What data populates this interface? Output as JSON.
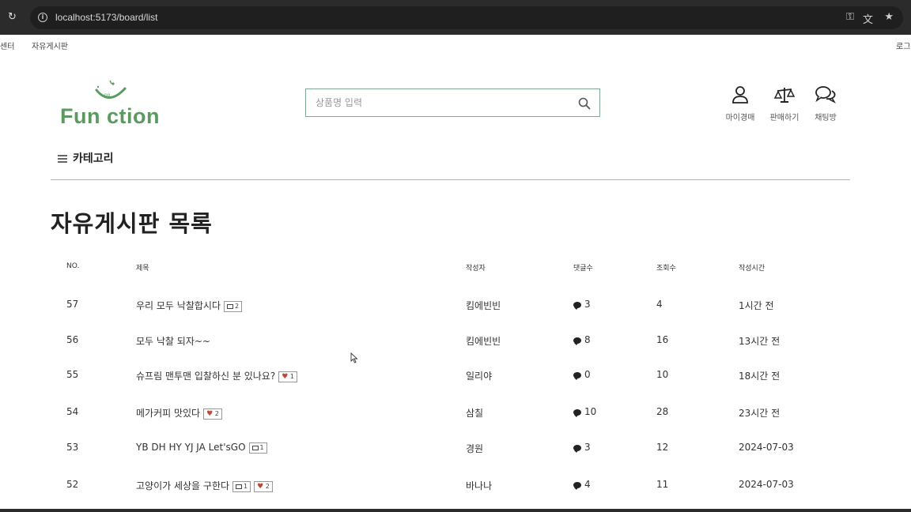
{
  "browser": {
    "url": "localhost:5173/board/list"
  },
  "utility_links": {
    "left_1": "센터",
    "left_2": "자유게시판",
    "right_1": "로그"
  },
  "logo": {
    "text": "Fun ction"
  },
  "search": {
    "placeholder": "상품명 입력"
  },
  "header_menu": {
    "my": "마이경매",
    "sell": "판매하기",
    "chat": "채팅방"
  },
  "category_label": "카테고리",
  "page_title": "자유게시판 목록",
  "table": {
    "headers": {
      "no": "NO.",
      "title": "제목",
      "author": "작성자",
      "comments": "댓글수",
      "views": "조회수",
      "time": "작성시간"
    },
    "rows": [
      {
        "no": "57",
        "title": "우리 모두 낙찰합시다",
        "images": "2",
        "likes": "",
        "author": "킴에빈빈",
        "comments": "3",
        "views": "4",
        "time": "1시간 전"
      },
      {
        "no": "56",
        "title": "모두 낙찰 되자~~",
        "images": "",
        "likes": "",
        "author": "킴에빈빈",
        "comments": "8",
        "views": "16",
        "time": "13시간 전"
      },
      {
        "no": "55",
        "title": "슈프림 맨투맨 입찰하신 분 있나요?",
        "images": "",
        "likes": "1",
        "author": "일리야",
        "comments": "0",
        "views": "10",
        "time": "18시간 전"
      },
      {
        "no": "54",
        "title": "메가커피 맛있다",
        "images": "",
        "likes": "2",
        "author": "삼칠",
        "comments": "10",
        "views": "28",
        "time": "23시간 전"
      },
      {
        "no": "53",
        "title": "YB DH HY YJ JA Let'sGO",
        "images": "1",
        "likes": "",
        "author": "경원",
        "comments": "3",
        "views": "12",
        "time": "2024-07-03"
      },
      {
        "no": "52",
        "title": "고양이가 세상을 구한다",
        "images": "1",
        "likes": "2",
        "author": "바나나",
        "comments": "4",
        "views": "11",
        "time": "2024-07-03"
      }
    ]
  }
}
